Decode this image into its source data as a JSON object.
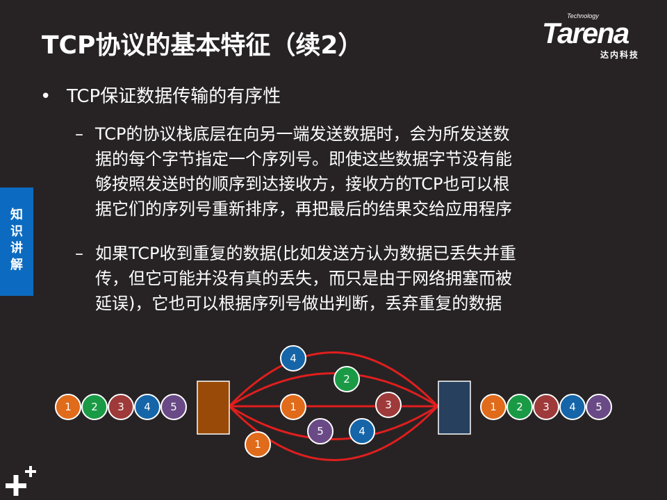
{
  "title": "TCP协议的基本特征（续2）",
  "logo": {
    "small": "Technology",
    "main": "Tarena",
    "sub": "达内科技"
  },
  "side_tab": [
    "知",
    "识",
    "讲",
    "解"
  ],
  "bullet": "TCP保证数据传输的有序性",
  "sub_points": [
    {
      "lines": [
        "TCP的协议栈底层在向另一端发送数据时，会为所发送数",
        "据的每个字节指定一个序列号。即使这些数据字节没有能",
        "够按照发送时的顺序到达接收方，接收方的TCP也可以根",
        "据它们的序列号重新排序，再把最后的结果交给应用程序"
      ]
    },
    {
      "lines": [
        "如果TCP收到重复的数据(比如发送方认为数据已丢失并重",
        "传，但它可能并没有真的丢失，而只是由于网络拥塞而被",
        "延误)，它也可以根据序列号做出判断，丢弃重复的数据"
      ]
    }
  ],
  "diagram": {
    "colors": {
      "orange": "#e06b1a",
      "green": "#1a9a45",
      "red": "#9e3a3a",
      "blue": "#1565a8",
      "purple": "#6a4a86",
      "sender_box": "#9a4a08",
      "receiver_box": "#27405e",
      "path": "#e01e1e"
    },
    "sender_sequence": [
      "1",
      "2",
      "3",
      "4",
      "5"
    ],
    "receiver_sequence": [
      "1",
      "2",
      "3",
      "4",
      "5"
    ],
    "in_transit": [
      "4",
      "2",
      "1",
      "3",
      "5",
      "4",
      "1"
    ]
  }
}
